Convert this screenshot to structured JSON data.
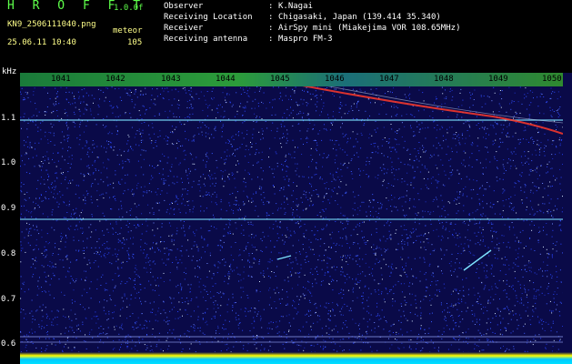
{
  "header": {
    "app_title": "H R O F F T",
    "app_version": "1.0.0f",
    "file_name": "KN9_2506111040.png",
    "mode": "meteor",
    "timestamp": "25.06.11 10:40",
    "count": "105",
    "info": [
      {
        "key": "Observer",
        "value": "K.Nagai"
      },
      {
        "key": "Receiving Location",
        "value": "Chigasaki, Japan (139.414 35.340)"
      },
      {
        "key": "Receiver",
        "value": "AirSpy mini (Miakejima VOR 108.65MHz)"
      },
      {
        "key": "Receiving antenna",
        "value": "Maspro FM-3"
      }
    ]
  },
  "axes": {
    "y_unit": "kHz",
    "x_ticks": [
      "1041",
      "1042",
      "1043",
      "1044",
      "1045",
      "1046",
      "1047",
      "1048",
      "1049",
      "1050"
    ],
    "y_ticks": [
      "1.1",
      "1.0",
      "0.9",
      "0.8",
      "0.7",
      "0.6"
    ]
  },
  "colors": {
    "background": "#0a0a48",
    "noise_blue": "#2a45ff",
    "noise_white": "#d8e8ff",
    "carrier_line": "#7de3ff",
    "title_green": "#5eff4a",
    "meta_yellow": "#ffff8a",
    "trace_red": "#ff3a2a"
  }
}
